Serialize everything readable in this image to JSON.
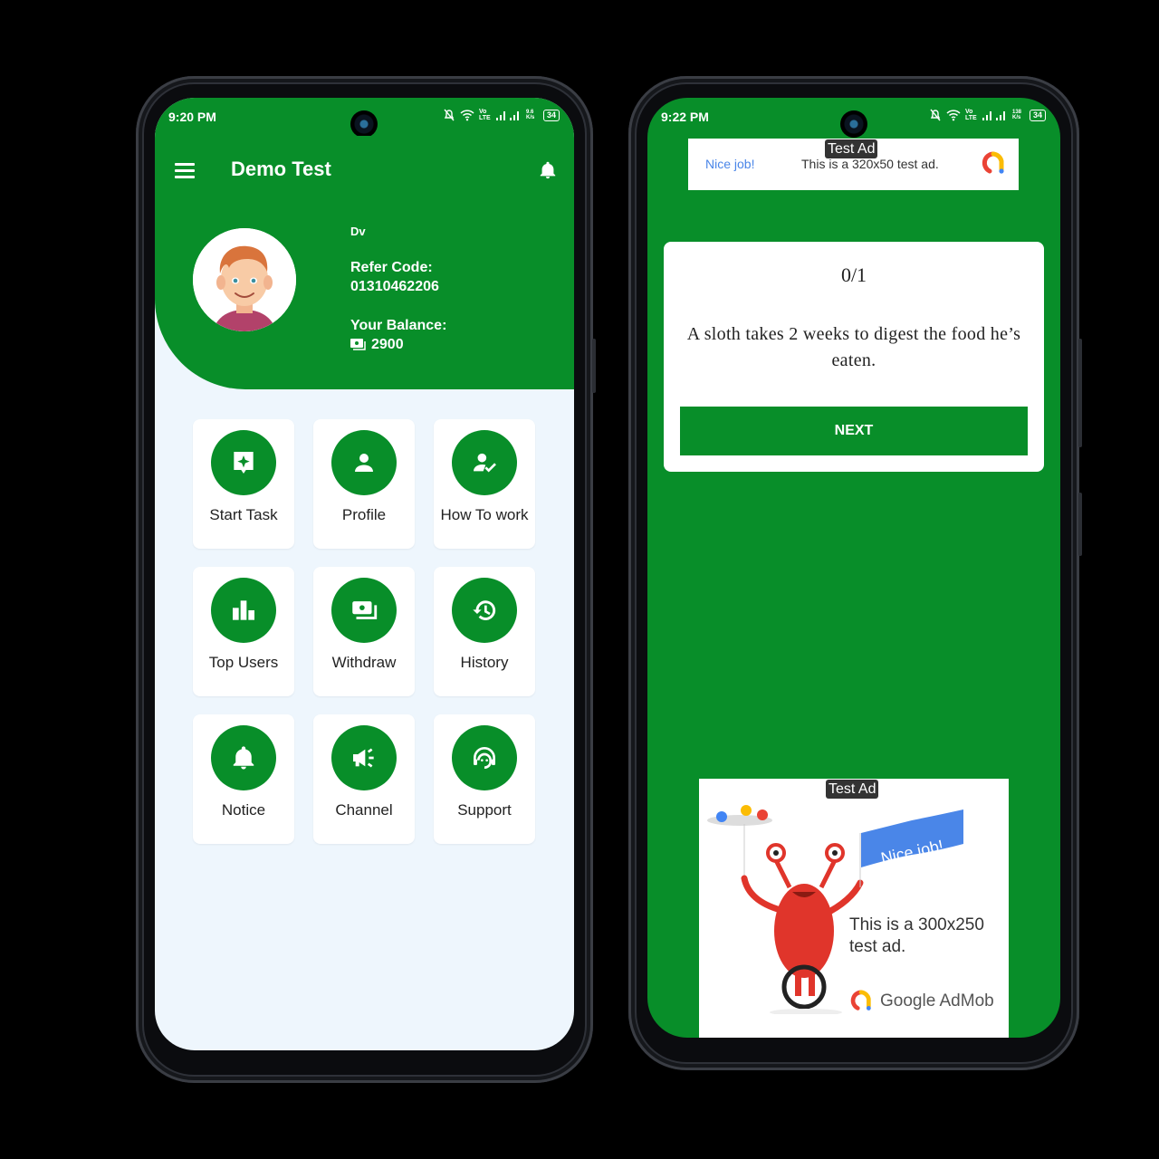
{
  "left_phone": {
    "status": {
      "time": "9:20 PM",
      "net_speed": "9.6 K/s",
      "battery": "34",
      "network": "Vo LTE"
    },
    "appbar": {
      "title": "Demo Test",
      "menu_icon": "menu-icon",
      "notification_icon": "bell-icon"
    },
    "user": {
      "name": "Dv",
      "refer_code_label": "Refer Code:",
      "refer_code": "01310462206",
      "balance_label": "Your Balance:",
      "balance": "2900",
      "balance_icon": "money-icon"
    },
    "menu": [
      {
        "label": "Start Task",
        "icon": "task-sparkle-icon"
      },
      {
        "label": "Profile",
        "icon": "person-icon"
      },
      {
        "label": "How To work",
        "icon": "person-check-icon"
      },
      {
        "label": "Top Users",
        "icon": "bar-chart-icon"
      },
      {
        "label": "Withdraw",
        "icon": "payments-icon"
      },
      {
        "label": "History",
        "icon": "history-icon"
      },
      {
        "label": "Notice",
        "icon": "bell-icon"
      },
      {
        "label": "Channel",
        "icon": "megaphone-icon"
      },
      {
        "label": "Support",
        "icon": "headset-icon"
      }
    ]
  },
  "right_phone": {
    "status": {
      "time": "9:22 PM",
      "net_speed": "138 K/s",
      "battery": "34",
      "network": "Vo LTE"
    },
    "banner_ad": {
      "tag": "Test Ad",
      "headline": "Nice job!",
      "text": "This is a 320x50 test ad."
    },
    "quiz": {
      "progress": "0/1",
      "fact": "A sloth takes 2 weeks to digest the food he’s eaten.",
      "next_label": "NEXT"
    },
    "mrec_ad": {
      "tag": "Test Ad",
      "flag_text": "Nice job!",
      "text": "This is a 300x250 test ad.",
      "brand": "Google AdMob"
    }
  },
  "colors": {
    "primary_green": "#088e29",
    "background": "#eef6fd",
    "ad_blue": "#4a86e8"
  }
}
